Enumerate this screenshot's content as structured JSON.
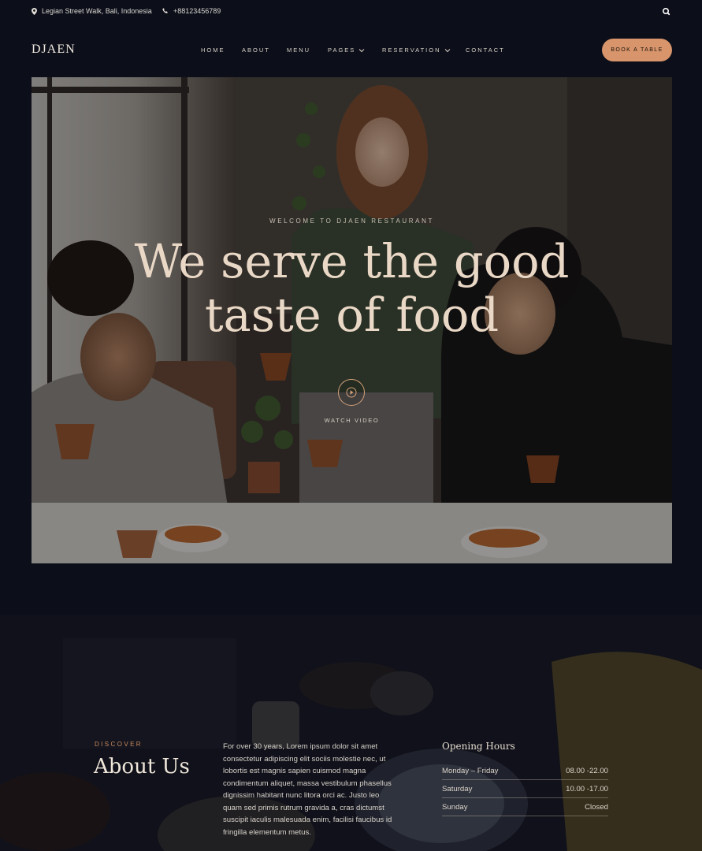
{
  "topbar": {
    "address": "Legian Street Walk, Bali, Indonesia",
    "phone": "+88123456789",
    "icons": [
      "map-pin-icon",
      "phone-icon",
      "search-icon"
    ]
  },
  "header": {
    "logo": "DJAEN",
    "nav": [
      {
        "label": "HOME"
      },
      {
        "label": "ABOUT"
      },
      {
        "label": "MENU"
      },
      {
        "label": "PAGES"
      },
      {
        "label": "RESERVATION"
      },
      {
        "label": "CONTACT"
      }
    ],
    "book_label": "BOOK A TABLE"
  },
  "hero": {
    "kicker": "WELCOME TO DJAEN RESTAURANT",
    "title_line1": "We serve the good",
    "title_line2": "taste of food",
    "watch_label": "WATCH VIDEO"
  },
  "about": {
    "discover": "DISCOVER",
    "title": "About Us",
    "text": "For over 30 years, Lorem ipsum dolor sit amet consectetur adipiscing elit sociis molestie nec, ut lobortis est magnis sapien cuismod magna condimentum aliquet, massa vestibulum phasellus dignissim habitant nunc litora orci ac. Justo leo quam sed primis rutrum gravida a, cras dictumst suscipit iaculis malesuada enim, facilisi faucibus id fringilla elementum metus.",
    "hours_title": "Opening Hours",
    "hours": [
      {
        "day": "Monday – Friday",
        "time": "08.00 -22.00"
      },
      {
        "day": "Saturday",
        "time": "10.00 -17.00"
      },
      {
        "day": "Sunday",
        "time": "Closed"
      }
    ]
  },
  "colors": {
    "background": "#0c0f1a",
    "accent": "#d8946a",
    "headline": "#ead8c6"
  }
}
